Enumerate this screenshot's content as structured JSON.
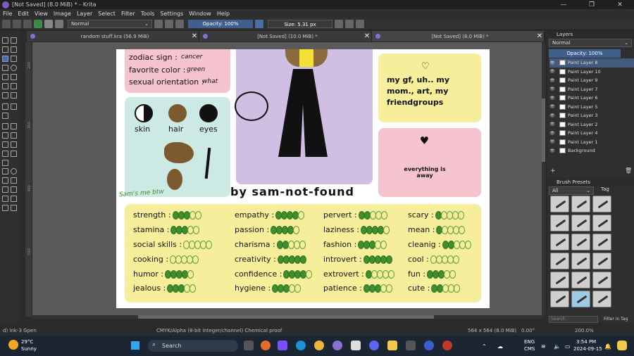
{
  "window": {
    "title": "[Not Saved]  (8.0 MiB) * - Krita",
    "controls": [
      "—",
      "❐",
      "✕"
    ]
  },
  "menu": [
    "File",
    "Edit",
    "View",
    "Image",
    "Layer",
    "Select",
    "Filter",
    "Tools",
    "Settings",
    "Window",
    "Help"
  ],
  "toolbar": {
    "blend_mode": "Normal",
    "opacity": "Opacity: 100%",
    "size": "Size: 5.31 px"
  },
  "tabs": [
    {
      "label": "random stuff.kra (56.9 MiB)",
      "close": "✕"
    },
    {
      "label": "[Not Saved]  (10.0 MiB) *",
      "close": "✕"
    },
    {
      "label": "[Not Saved]  (8.0 MiB) *",
      "close": "✕"
    }
  ],
  "ruler": [
    "200",
    "300",
    "400",
    "500"
  ],
  "document": {
    "zodiac_label": "zodiac sign :",
    "zodiac_value": "cancer",
    "color_label": "favorite color :",
    "color_value": "green",
    "orientation_label": "sexual orientation :",
    "orientation_value": "what",
    "skin": "skin",
    "hair": "hair",
    "eyes": "eyes",
    "signature_note": "Sam's me btw",
    "byline": "by sam-not-found",
    "likes": "my gf, uh.. my mom., art, my friendgroups",
    "dislikes": "everything is away",
    "stats": [
      {
        "label": "strength :",
        "filled": 3,
        "total": 5
      },
      {
        "label": "stamina :",
        "filled": 3,
        "total": 5
      },
      {
        "label": "social skills :",
        "filled": 0,
        "total": 5
      },
      {
        "label": "cooking :",
        "filled": 0,
        "total": 5
      },
      {
        "label": "humor :",
        "filled": 4,
        "total": 5
      },
      {
        "label": "jealous :",
        "filled": 3,
        "total": 5
      },
      {
        "label": "empathy :",
        "filled": 4,
        "total": 5
      },
      {
        "label": "passion :",
        "filled": 4,
        "total": 5
      },
      {
        "label": "charisma :",
        "filled": 2,
        "total": 5
      },
      {
        "label": "creativity :",
        "filled": 5,
        "total": 5
      },
      {
        "label": "confidence :",
        "filled": 4,
        "total": 5
      },
      {
        "label": "hygiene :",
        "filled": 3,
        "total": 5
      },
      {
        "label": "pervert :",
        "filled": 2,
        "total": 5
      },
      {
        "label": "laziness :",
        "filled": 4,
        "total": 5
      },
      {
        "label": "fashion :",
        "filled": 3,
        "total": 5
      },
      {
        "label": "introvert :",
        "filled": 5,
        "total": 5
      },
      {
        "label": "extrovert :",
        "filled": 1,
        "total": 5
      },
      {
        "label": "patience :",
        "filled": 3,
        "total": 5
      },
      {
        "label": "scary :",
        "filled": 1,
        "total": 5
      },
      {
        "label": "mean :",
        "filled": 1,
        "total": 5
      },
      {
        "label": "cleanig :",
        "filled": 2,
        "total": 5
      },
      {
        "label": "cool :",
        "filled": 0,
        "total": 5
      },
      {
        "label": "fun :",
        "filled": 3,
        "total": 5
      },
      {
        "label": "cute :",
        "filled": 2,
        "total": 5
      }
    ]
  },
  "layers_panel": {
    "title": "Layers",
    "blend": "Normal",
    "opacity": "Opacity: 100%",
    "layers": [
      "Paint Layer 8",
      "Paint Layer 10",
      "Paint Layer 9",
      "Paint Layer 7",
      "Paint Layer 6",
      "Paint Layer 5",
      "Paint Layer 3",
      "Paint Layer 2",
      "Paint Layer 4",
      "Paint Layer 1",
      "Background"
    ]
  },
  "brush_panel": {
    "title": "Brush Presets",
    "filter": "All",
    "tag": "Tag",
    "search": "Search",
    "filter_in_tag": "Filter in Tag"
  },
  "status": {
    "tool": "d) Ink-3 Gpen",
    "color": "CMYK/Alpha (8-bit integer/channel)  Chemical proof",
    "size": "564 x 564 (8.0 MiB)",
    "rotation": "0.00°",
    "zoom": "200.0%"
  },
  "taskbar": {
    "temp": "29°C",
    "weather": "Sunny",
    "search": "Search",
    "lang1": "ENG",
    "lang2": "CMS",
    "time": "3:54 PM",
    "date": "2024-09-15"
  },
  "colors": {
    "pink": "#f6c4ce",
    "lavender": "#cfc0e3",
    "yellow": "#f6ee9a",
    "mint": "#cde9e4",
    "oval_green": "#3f8f2c",
    "accent": "#4a6fa5"
  }
}
